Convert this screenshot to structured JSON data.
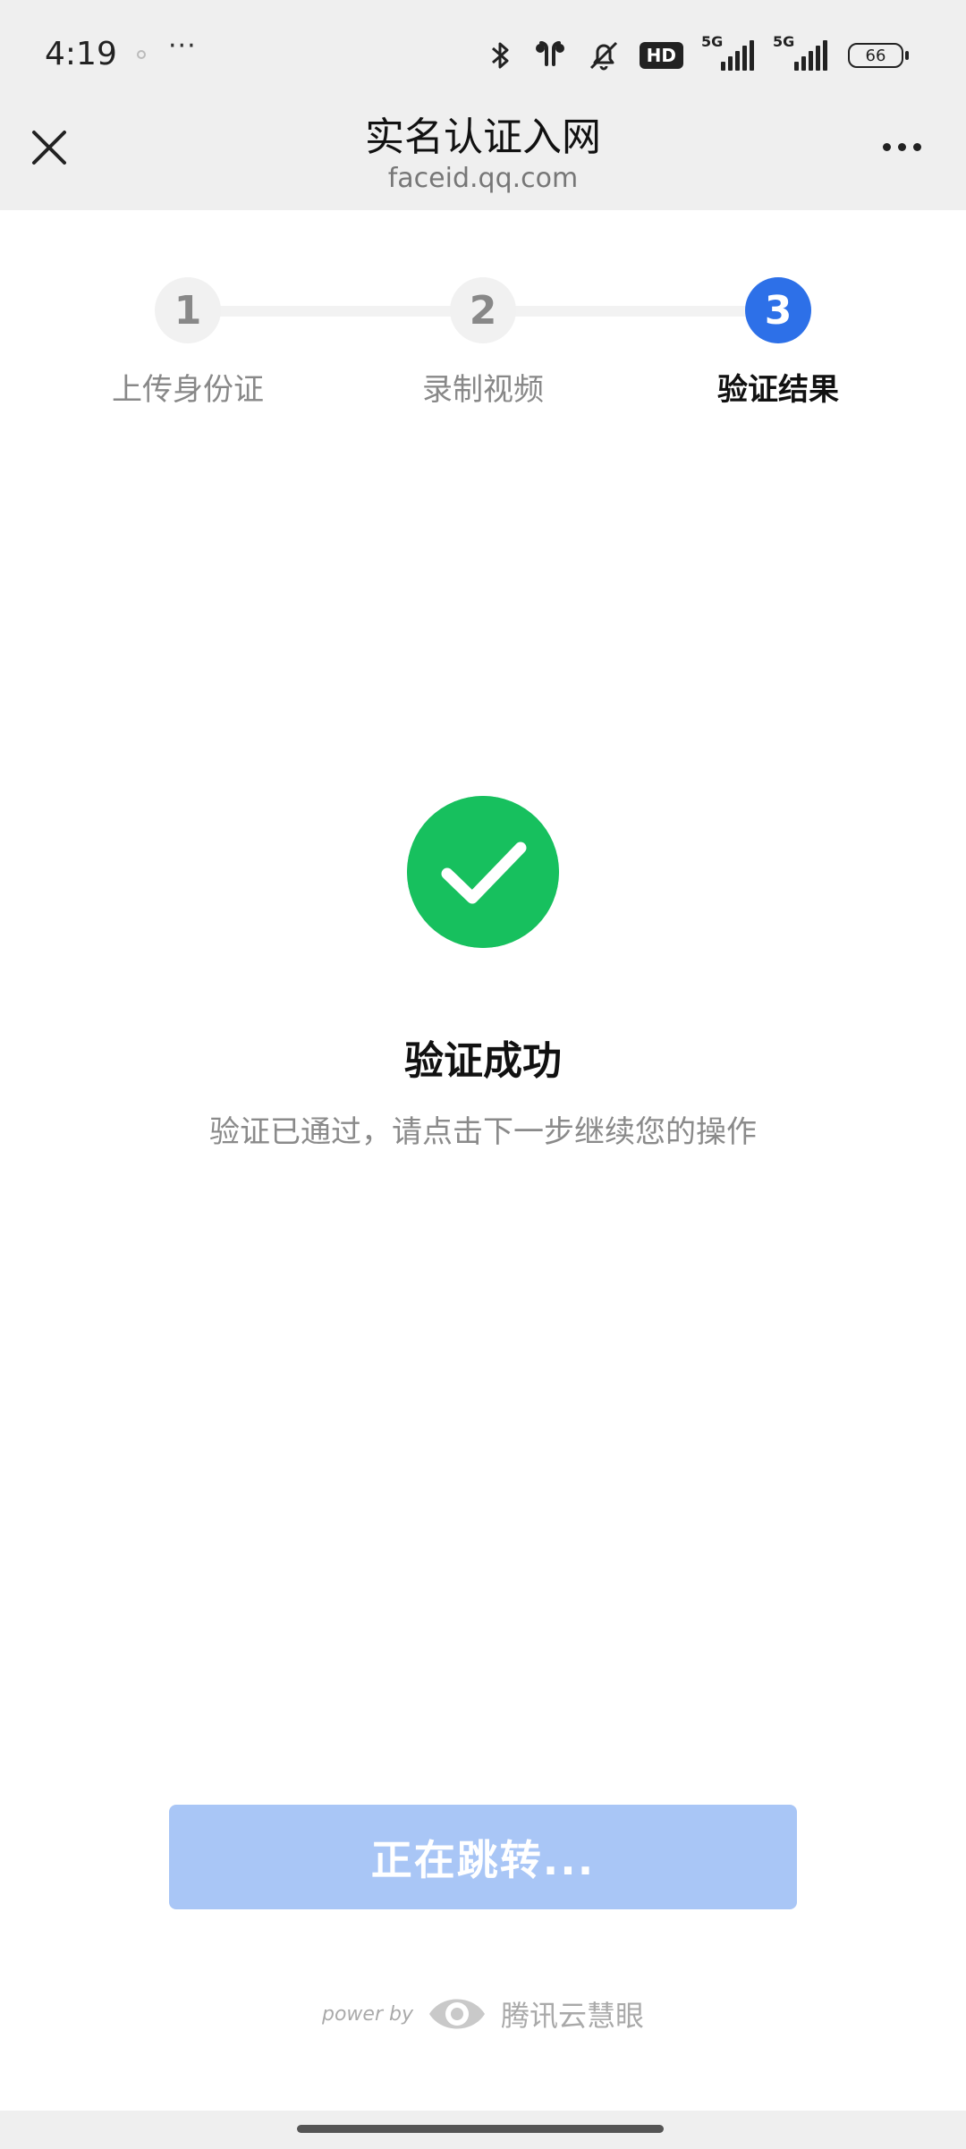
{
  "status_bar": {
    "time": "4:19",
    "more": "···",
    "hd_badge": "HD",
    "sig1_tag": "5G",
    "sig2_tag": "5G",
    "battery": "66"
  },
  "header": {
    "title": "实名认证入网",
    "subtitle": "faceid.qq.com"
  },
  "steps": [
    {
      "number": "1",
      "label": "上传身份证"
    },
    {
      "number": "2",
      "label": "录制视频"
    },
    {
      "number": "3",
      "label": "验证结果"
    }
  ],
  "result": {
    "title": "验证成功",
    "description": "验证已通过，请点击下一步继续您的操作"
  },
  "button": {
    "label": "正在跳转..."
  },
  "footer": {
    "power_by": "power by",
    "brand": "腾讯云慧眼"
  },
  "colors": {
    "accent": "#2d70e8",
    "success": "#17c05e",
    "button_disabled": "#a9c6f6"
  }
}
